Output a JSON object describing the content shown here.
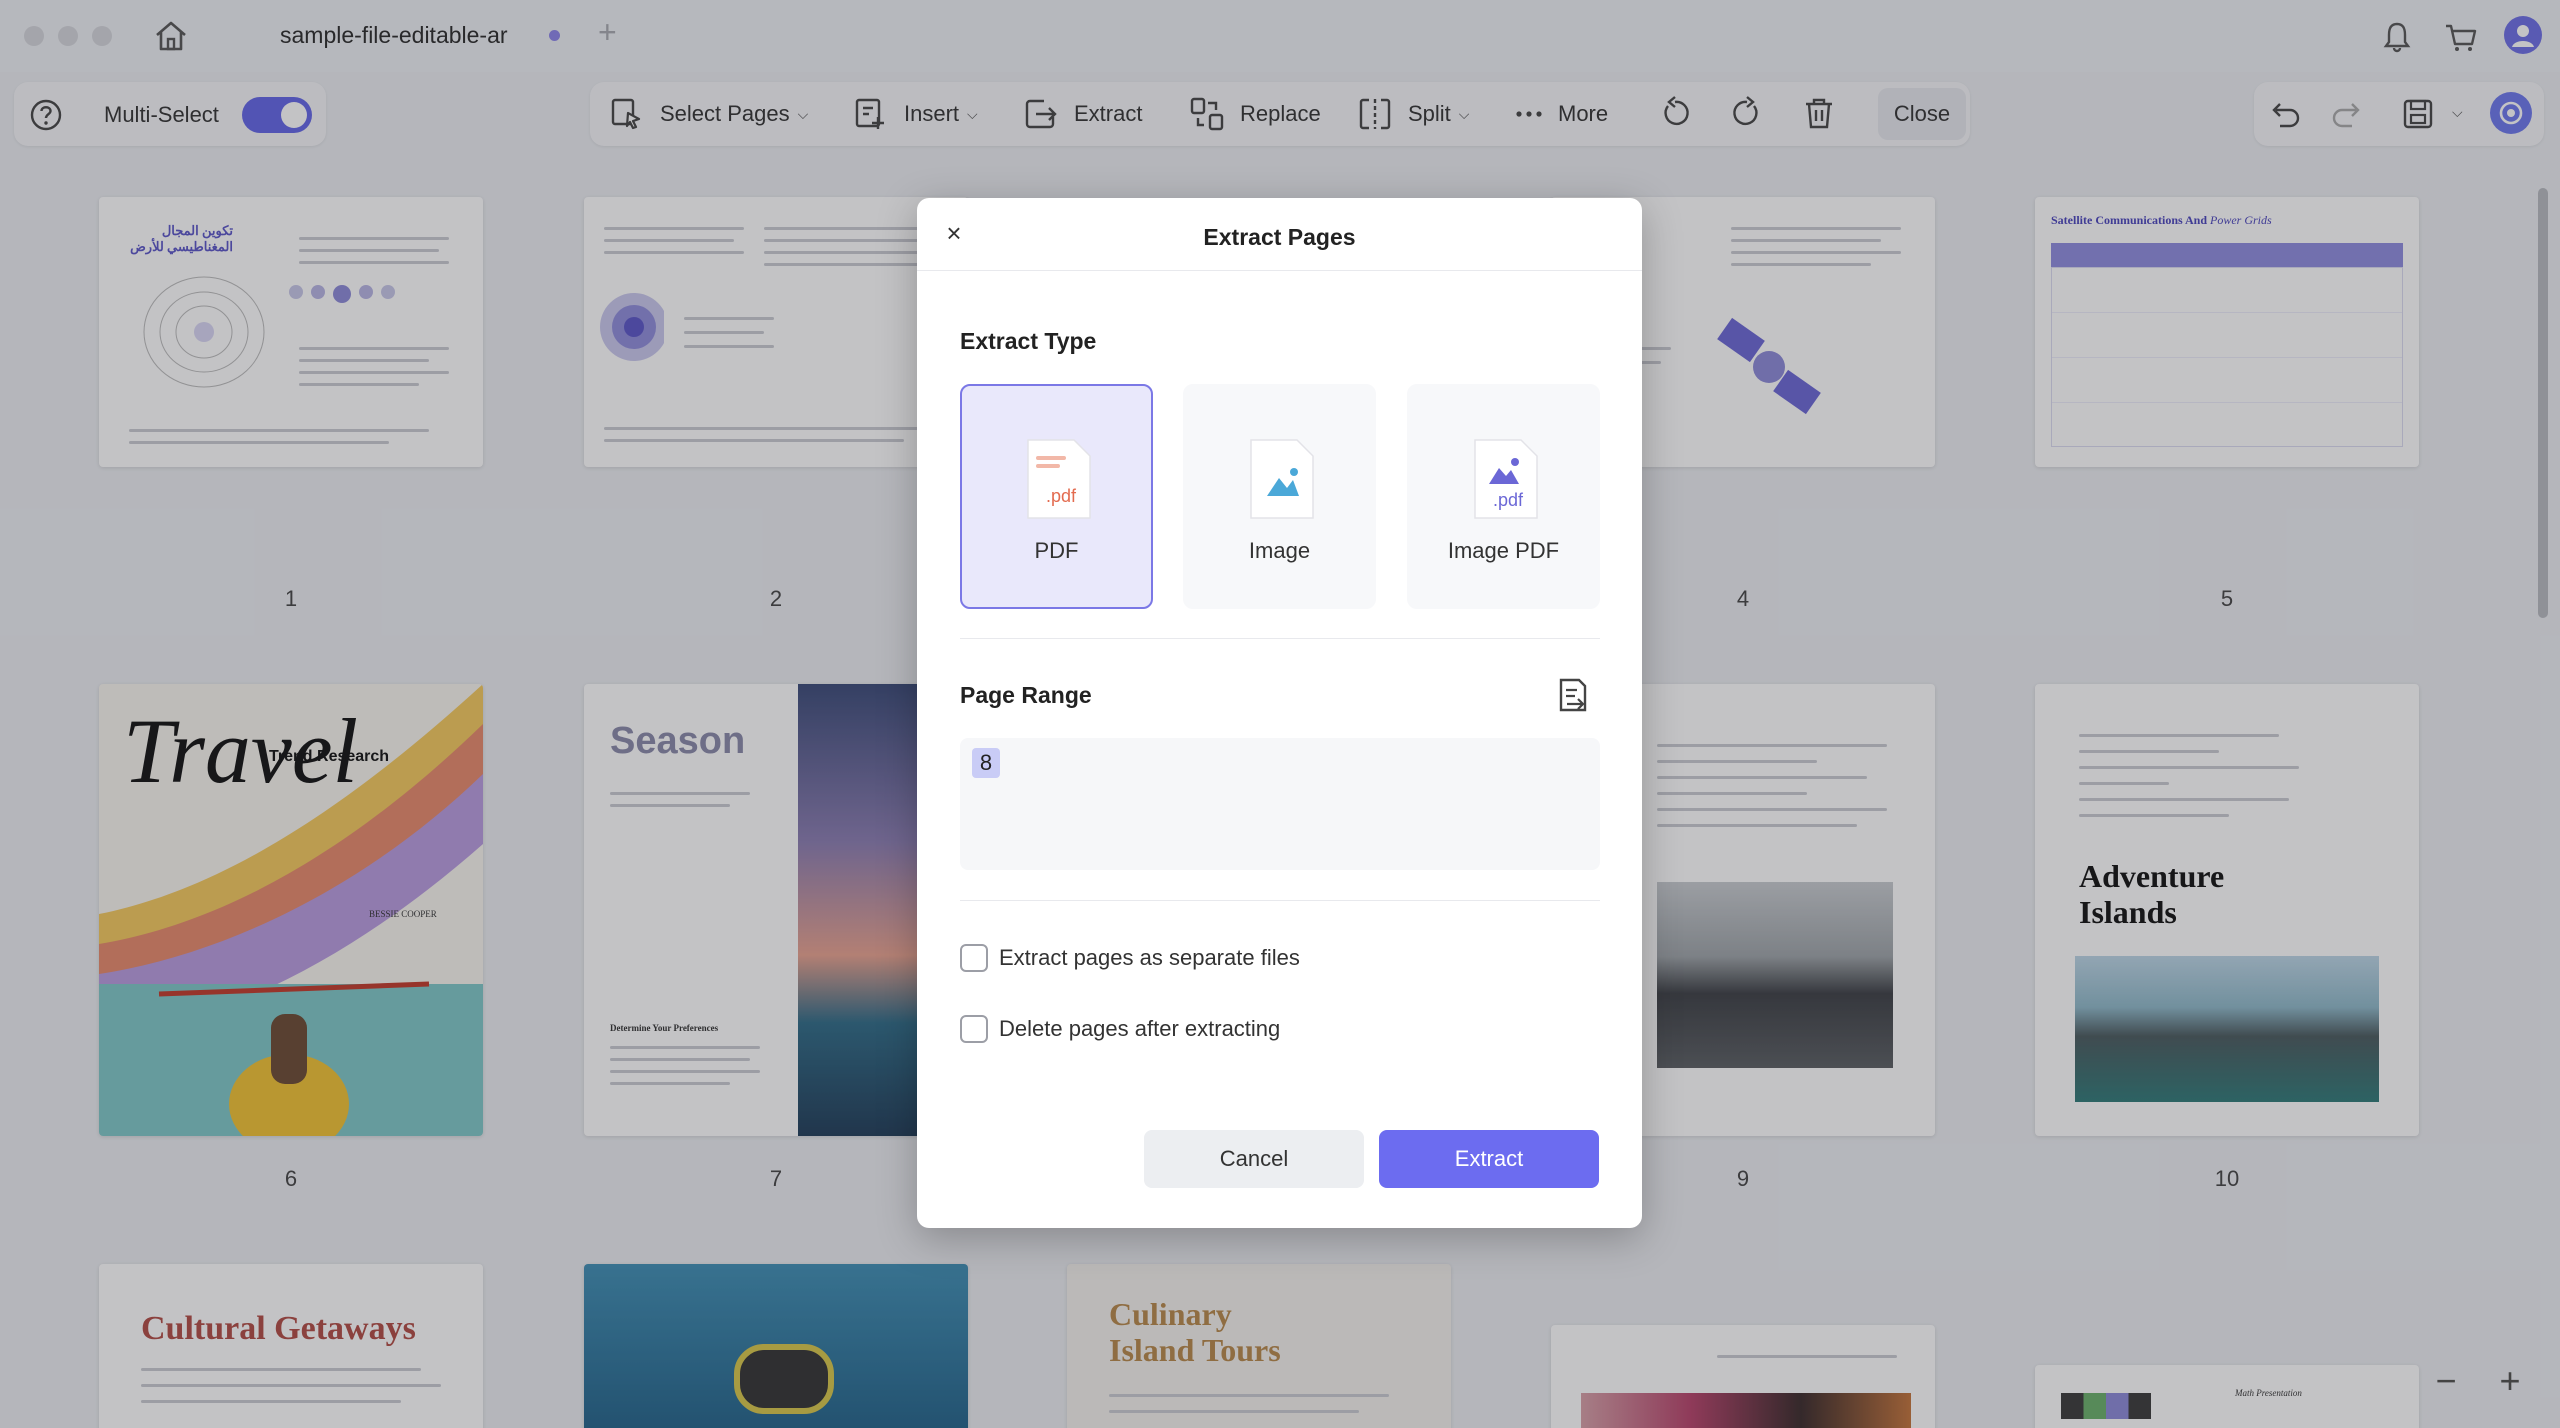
{
  "window": {
    "tab_title": "sample-file-editable-ar"
  },
  "toolbar": {
    "multi_select_label": "Multi-Select",
    "multi_select_on": true,
    "select_pages": "Select Pages",
    "insert": "Insert",
    "extract": "Extract",
    "replace": "Replace",
    "split": "Split",
    "more": "More",
    "close": "Close"
  },
  "pages": [
    {
      "number": "1",
      "title": "تكوين المجال المغناطيسي للأرض"
    },
    {
      "number": "2"
    },
    {
      "number": "4"
    },
    {
      "number": "5",
      "title": "Satellite Communications And",
      "title_italic": "Power Grids"
    },
    {
      "number": "6",
      "title": "Travel",
      "subtitle": "Trend Research",
      "author": "BESSIE COOPER"
    },
    {
      "number": "7",
      "title": "Season",
      "subtitle": "Determine Your Preferences"
    },
    {
      "number": "9"
    },
    {
      "number": "10",
      "title": "Adventure Islands"
    },
    {
      "title": "Cultural Getaways"
    },
    {
      "title": "Culinary Island Tours"
    },
    {
      "title": "Math Presentation"
    }
  ],
  "dialog": {
    "title": "Extract Pages",
    "extract_type_label": "Extract Type",
    "types": [
      {
        "label": "PDF",
        "selected": true
      },
      {
        "label": "Image",
        "selected": false
      },
      {
        "label": "Image PDF",
        "selected": false
      }
    ],
    "page_range_label": "Page Range",
    "page_range_value": "8",
    "option_separate": "Extract pages as separate files",
    "option_separate_checked": false,
    "option_delete": "Delete pages after extracting",
    "option_delete_checked": false,
    "cancel": "Cancel",
    "extract": "Extract"
  },
  "colors": {
    "accent": "#6c6cf0",
    "selected_card": "#e9e8fb"
  }
}
